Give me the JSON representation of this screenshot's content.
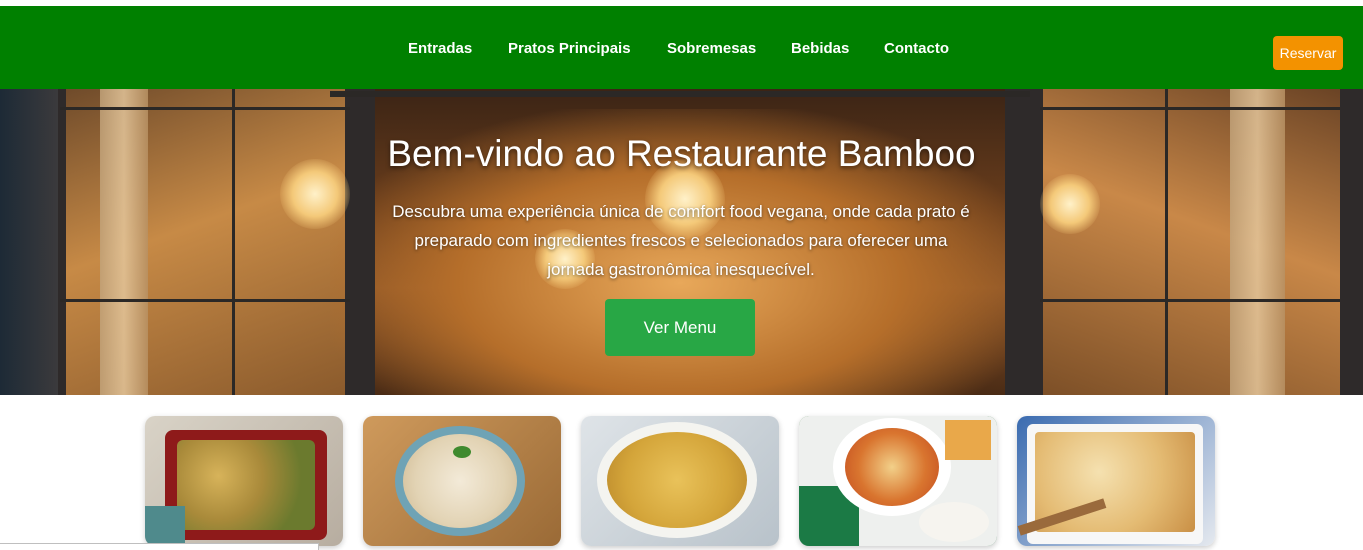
{
  "nav": {
    "links": [
      {
        "label": "Entradas"
      },
      {
        "label": "Pratos Principais"
      },
      {
        "label": "Sobremesas"
      },
      {
        "label": "Bebidas"
      },
      {
        "label": "Contacto"
      }
    ],
    "reserve_label": "Reservar"
  },
  "hero": {
    "title": "Bem-vindo ao Restaurante Bamboo",
    "description": "Descubra uma experiência única de comfort food vegana, onde cada prato é preparado com ingredientes frescos e selecionados para oferecer uma jornada gastronômica inesquecível.",
    "button_label": "Ver Menu"
  },
  "colors": {
    "navbar": "#008000",
    "reserve_button": "#f39200",
    "menu_button": "#28a745"
  },
  "dishes": [
    {
      "image": "roasted-chicken-potatoes-dish"
    },
    {
      "image": "rice-bowl-dish"
    },
    {
      "image": "gratin-rice-dish"
    },
    {
      "image": "breaded-tomato-sauce-dish"
    },
    {
      "image": "lasagna-dish"
    }
  ]
}
